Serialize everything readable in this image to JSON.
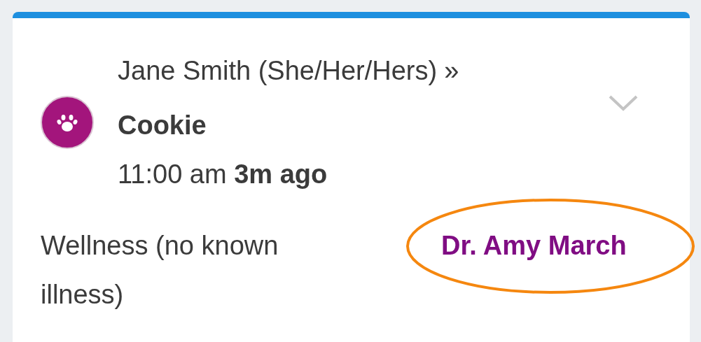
{
  "appointment": {
    "owner": "Jane Smith (She/Her/Hers)",
    "separator": "»",
    "pet": "Cookie",
    "time": "11:00 am **3m ago**",
    "expanded": false,
    "reason": "Wellness (no known illness)",
    "doctor": "Dr. Amy March",
    "doctor_highlighted": true
  }
}
